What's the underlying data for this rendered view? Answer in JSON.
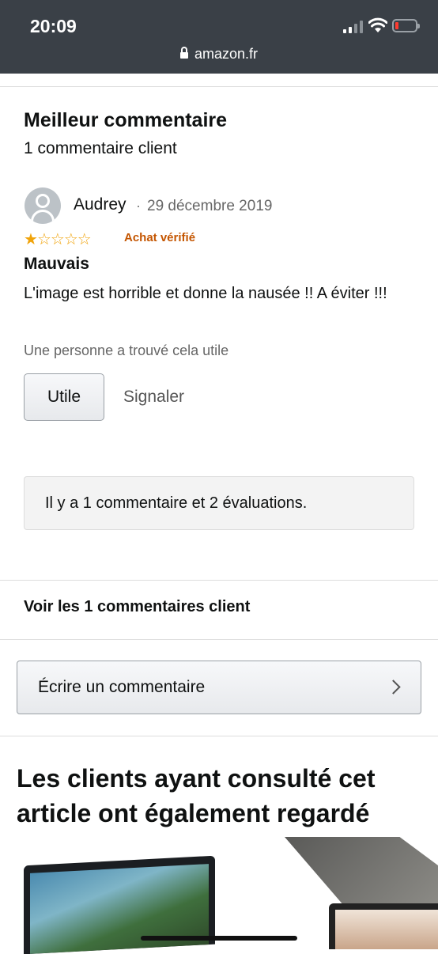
{
  "status_bar": {
    "time": "20:09",
    "url": "amazon.fr",
    "icons": [
      "signal-icon",
      "wifi-icon",
      "battery-low-icon",
      "lock-icon"
    ]
  },
  "review_section": {
    "heading": "Meilleur commentaire",
    "count": "1 commentaire client",
    "review": {
      "author": "Audrey",
      "separator": "·",
      "date": "29 décembre 2019",
      "rating": 1,
      "rating_max": 5,
      "verified": "Achat vérifié",
      "title": "Mauvais",
      "body": "L'image est horrible et donne la nausée !! A éviter !!!",
      "helpful_text": "Une personne a trouvé cela utile",
      "helpful_button": "Utile",
      "report_link": "Signaler"
    },
    "summary": "Il y a 1 commentaire et 2 évaluations."
  },
  "see_all_link": "Voir les 1 commentaires client",
  "write_review_button": "Écrire un commentaire",
  "related_heading": "Les clients ayant consulté cet article ont également regardé",
  "colors": {
    "star": "#f0a30a",
    "verified": "#c45500",
    "status_bar": "#3a4047"
  }
}
